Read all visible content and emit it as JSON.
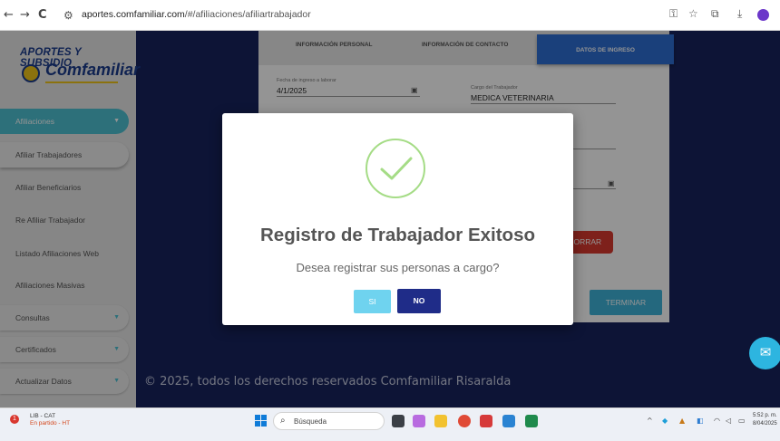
{
  "browser": {
    "url_host": "aportes.comfamiliar.com",
    "url_path": "/#/afiliaciones/afiliartrabajador",
    "back": "←",
    "forward": "→",
    "reload": "C"
  },
  "sidebar": {
    "logo_title": "APORTES Y SUBSIDIO",
    "logo_name": "Comfamiliar",
    "items": [
      {
        "label": "Afiliaciones"
      },
      {
        "label": "Afiliar Trabajadores"
      },
      {
        "label": "Afiliar Beneficiarios"
      },
      {
        "label": "Re Afiliar Trabajador"
      },
      {
        "label": "Listado Afiliaciones Web"
      },
      {
        "label": "Afiliaciones Masivas"
      },
      {
        "label": "Consultas"
      },
      {
        "label": "Certificados"
      },
      {
        "label": "Actualizar Datos"
      }
    ]
  },
  "form": {
    "tabs": [
      "INFORMACIÓN PERSONAL",
      "INFORMACIÓN DE CONTACTO",
      "DATOS DE INGRESO"
    ],
    "fecha_label": "Fecha de ingreso a laborar",
    "fecha_value": "4/1/2025",
    "cargo_label": "Cargo del Trabajador",
    "cargo_value": "MEDICA VETERINARIA",
    "borrar_label": "BORRAR",
    "terminar_label": "TERMINAR"
  },
  "footer": {
    "text": "© 2025, todos los derechos reservados Comfamiliar Risaralda"
  },
  "modal": {
    "title": "Registro de Trabajador Exitoso",
    "subtitle": "Desea registrar sus personas a cargo?",
    "yes_label": "SI",
    "no_label": "NO",
    "accent_color": "#a5dc86"
  },
  "taskbar": {
    "weather_badge": "1",
    "weather_line1": "LIB - CAT",
    "weather_line2": "En partido - HT",
    "search_placeholder": "Búsqueda",
    "clock_time": "5:52 p. m.",
    "clock_date": "8/04/2025"
  }
}
